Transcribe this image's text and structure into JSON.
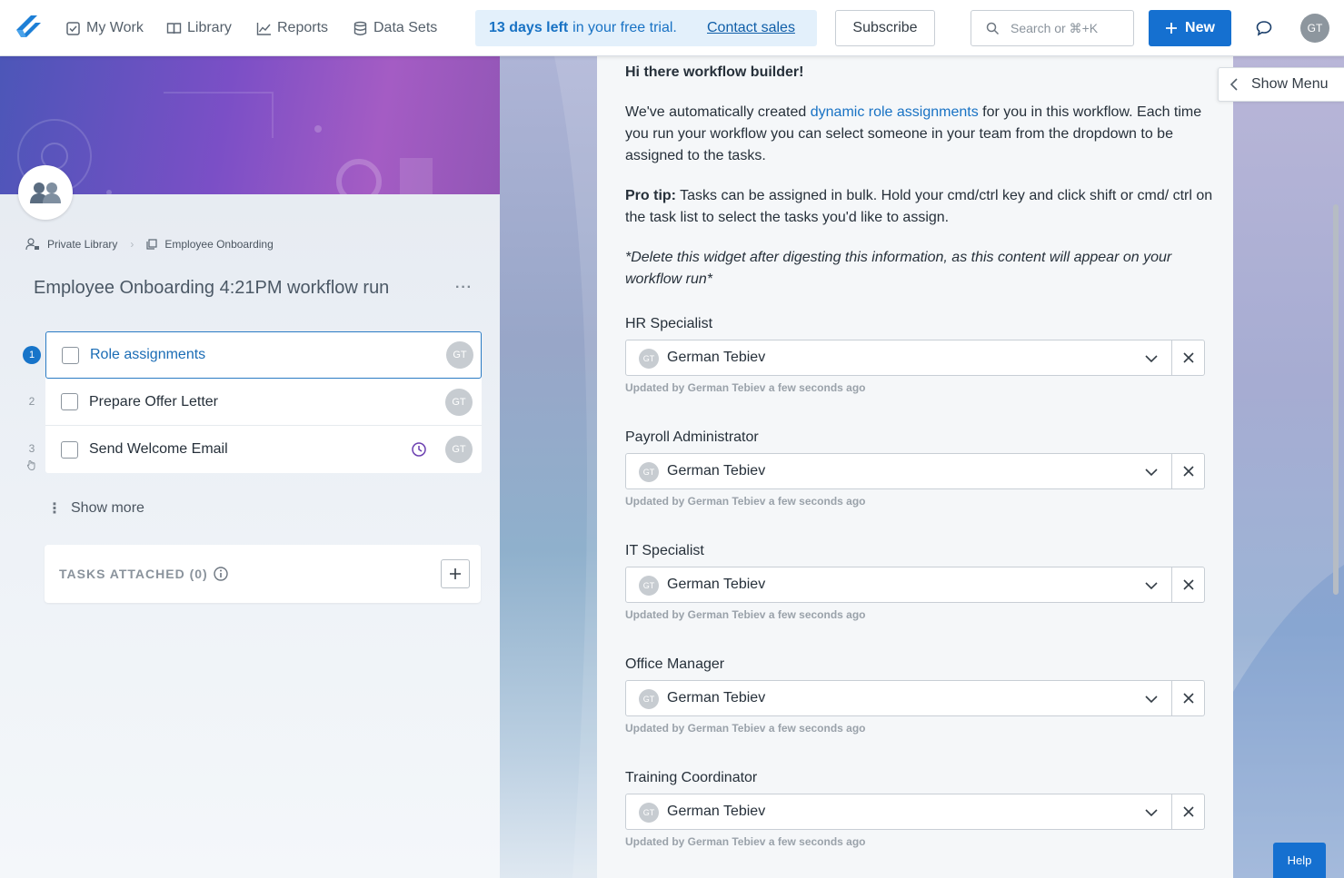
{
  "nav": {
    "items": [
      {
        "label": "My Work",
        "icon": "checkbox-icon"
      },
      {
        "label": "Library",
        "icon": "book-icon"
      },
      {
        "label": "Reports",
        "icon": "chart-line-icon"
      },
      {
        "label": "Data Sets",
        "icon": "database-icon"
      }
    ],
    "trial_bold": "13 days left",
    "trial_rest": "in your free trial.",
    "contact_sales": "Contact sales",
    "subscribe": "Subscribe",
    "search_placeholder": "Search or ⌘+K",
    "new_button": "New",
    "user_initials": "GT"
  },
  "left": {
    "breadcrumb": [
      "Private Library",
      "Employee Onboarding"
    ],
    "title": "Employee Onboarding 4:21PM workflow run",
    "tasks": [
      {
        "num": "1",
        "label": "Role assignments",
        "assignee": "GT"
      },
      {
        "num": "2",
        "label": "Prepare Offer Letter",
        "assignee": "GT"
      },
      {
        "num": "3",
        "label": "Send Welcome Email",
        "assignee": "GT"
      }
    ],
    "show_more": "Show more",
    "tasks_attached": "TASKS ATTACHED (0)"
  },
  "main": {
    "greeting": "Hi there workflow builder!",
    "p1_before": "We've automatically created",
    "p1_link": "dynamic role assignments",
    "p1_after": "for you in this workflow. Each time you run your workflow you can select someone in your team from the dropdown to be assigned to the tasks.",
    "p2_bold": "Pro tip:",
    "p2_rest": "Tasks can be assigned in bulk. Hold your cmd/ctrl key and click shift or cmd/ ctrl on the task list to select the tasks you'd like to assign.",
    "p3": "*Delete this widget after digesting this information, as this content will appear on your workflow run*",
    "roles": [
      {
        "label": "HR Specialist",
        "value": "German Tebiev",
        "initials": "GT",
        "updated": "Updated by German Tebiev a few seconds ago"
      },
      {
        "label": "Payroll Administrator",
        "value": "German Tebiev",
        "initials": "GT",
        "updated": "Updated by German Tebiev a few seconds ago"
      },
      {
        "label": "IT Specialist",
        "value": "German Tebiev",
        "initials": "GT",
        "updated": "Updated by German Tebiev a few seconds ago"
      },
      {
        "label": "Office Manager",
        "value": "German Tebiev",
        "initials": "GT",
        "updated": "Updated by German Tebiev a few seconds ago"
      },
      {
        "label": "Training Coordinator",
        "value": "German Tebiev",
        "initials": "GT",
        "updated": "Updated by German Tebiev a few seconds ago"
      }
    ]
  },
  "right": {
    "show_menu": "Show Menu",
    "help": "Help"
  },
  "colors": {
    "accent": "#1570d0",
    "trial_bg": "#e3f0fb"
  }
}
